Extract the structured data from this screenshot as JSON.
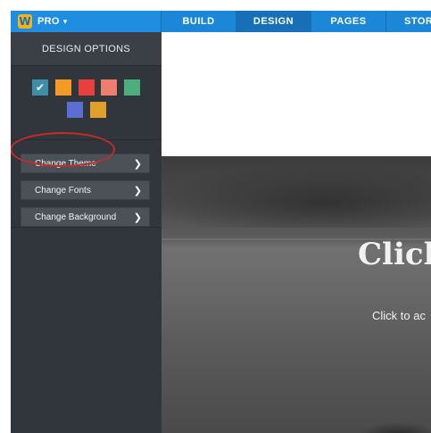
{
  "topbar": {
    "logo_letter": "W",
    "plan_label": "PRO",
    "nav": [
      "BUILD",
      "DESIGN",
      "PAGES",
      "STOR"
    ],
    "active": "DESIGN"
  },
  "sidebar": {
    "header": "DESIGN OPTIONS",
    "swatches": [
      {
        "color": "#3d8fa8",
        "selected": true
      },
      {
        "color": "#f59a23"
      },
      {
        "color": "#e8413b"
      },
      {
        "color": "#f07d6e"
      },
      {
        "color": "#4cae7c"
      },
      {
        "color": "#5b6fd0"
      },
      {
        "color": "#e0a02c"
      }
    ],
    "menu": [
      {
        "label": "Change Theme"
      },
      {
        "label": "Change Fonts"
      },
      {
        "label": "Change Background"
      }
    ]
  },
  "canvas": {
    "hero_title": "Click",
    "hero_subtitle": "Click to ac"
  }
}
